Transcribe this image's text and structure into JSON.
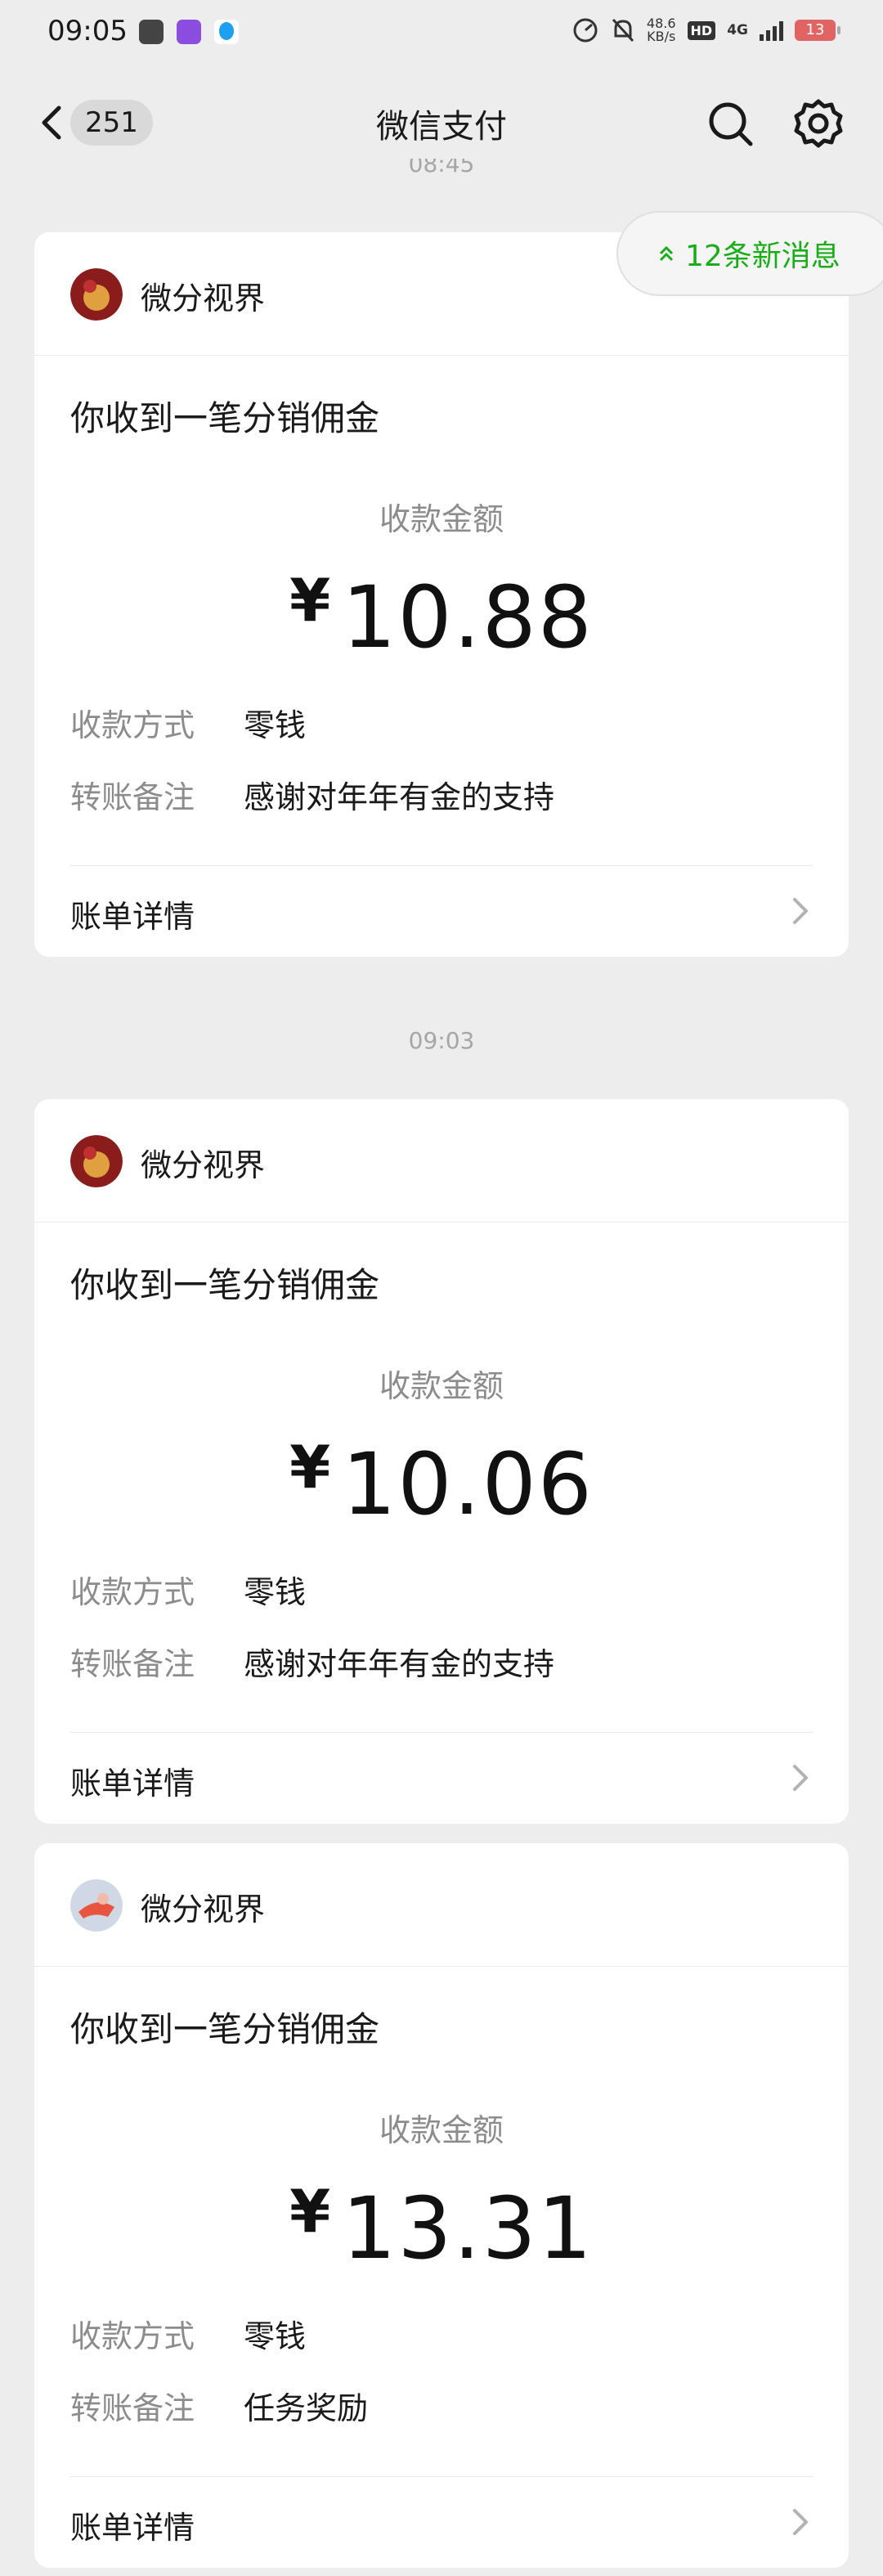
{
  "status_bar": {
    "time": "09:05",
    "net_speed_top": "48.6",
    "net_speed_bottom": "KB/s",
    "hd": "HD",
    "network": "4G",
    "battery": "13"
  },
  "nav": {
    "unread_count": "251",
    "title": "微信支付"
  },
  "partial_time": "08:45",
  "new_messages": "12条新消息",
  "cards": [
    {
      "sender": "微分视界",
      "title": "你收到一笔分销佣金",
      "amount_label": "收款金额",
      "currency": "¥",
      "amount": "10.88",
      "method_label": "收款方式",
      "method_value": "零钱",
      "note_label": "转账备注",
      "note_value": "感谢对年年有金的支持",
      "detail": "账单详情"
    },
    {
      "time": "09:03",
      "sender": "微分视界",
      "title": "你收到一笔分销佣金",
      "amount_label": "收款金额",
      "currency": "¥",
      "amount": "10.06",
      "method_label": "收款方式",
      "method_value": "零钱",
      "note_label": "转账备注",
      "note_value": "感谢对年年有金的支持",
      "detail": "账单详情"
    },
    {
      "sender": "微分视界",
      "title": "你收到一笔分销佣金",
      "amount_label": "收款金额",
      "currency": "¥",
      "amount": "13.31",
      "method_label": "收款方式",
      "method_value": "零钱",
      "note_label": "转账备注",
      "note_value": "任务奖励",
      "detail": "账单详情"
    }
  ],
  "colors": {
    "accent_green": "#1aad19",
    "background": "#ededed"
  }
}
